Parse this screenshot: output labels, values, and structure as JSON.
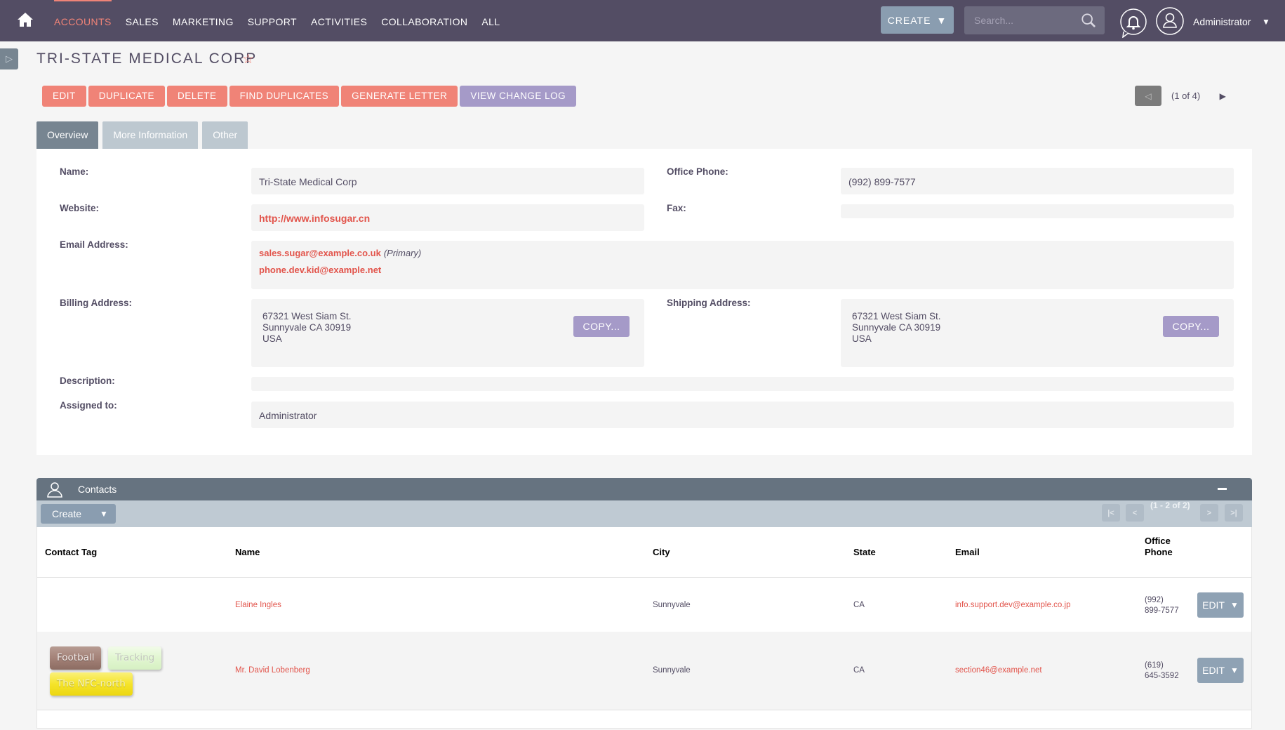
{
  "nav": {
    "items": [
      {
        "label": "ACCOUNTS",
        "active": true
      },
      {
        "label": "SALES",
        "active": false
      },
      {
        "label": "MARKETING",
        "active": false
      },
      {
        "label": "SUPPORT",
        "active": false
      },
      {
        "label": "ACTIVITIES",
        "active": false
      },
      {
        "label": "COLLABORATION",
        "active": false
      },
      {
        "label": "ALL",
        "active": false
      }
    ],
    "create_label": "CREATE",
    "search_placeholder": "Search...",
    "user_name": "Administrator",
    "icons": {
      "home": "home-icon",
      "search": "search-icon",
      "notifications": "bell-icon",
      "user": "user-avatar-icon",
      "caret": "caret-down-icon"
    }
  },
  "colors": {
    "nav_bg": "#534d64",
    "accent": "#f08377",
    "secondary_button": "#a59ac8",
    "link": "#e2544b"
  },
  "record": {
    "title": "TRI-STATE MEDICAL CORP",
    "favorite_icon": "star-outline-icon",
    "actions": [
      "EDIT",
      "DUPLICATE",
      "DELETE",
      "FIND DUPLICATES",
      "GENERATE LETTER",
      "VIEW CHANGE LOG"
    ],
    "pager": {
      "count": "(1 of 4)"
    }
  },
  "tabs": [
    {
      "label": "Overview",
      "active": true
    },
    {
      "label": "More Information",
      "active": false
    },
    {
      "label": "Other",
      "active": false
    }
  ],
  "fields": {
    "name": {
      "label": "Name:",
      "value": "Tri-State Medical Corp"
    },
    "office_phone": {
      "label": "Office Phone:",
      "value": "(992) 899-7577"
    },
    "website": {
      "label": "Website:",
      "value": "http://www.infosugar.cn"
    },
    "fax": {
      "label": "Fax:",
      "value": ""
    },
    "email": {
      "label": "Email Address:",
      "addresses": [
        {
          "value": "sales.sugar@example.co.uk",
          "note": "(Primary)"
        },
        {
          "value": "phone.dev.kid@example.net",
          "note": ""
        }
      ]
    },
    "billing_address": {
      "label": "Billing Address:",
      "line1": "67321 West Siam St.",
      "line2": "Sunnyvale CA  30919",
      "line3": "USA",
      "copy_label": "COPY..."
    },
    "shipping_address": {
      "label": "Shipping Address:",
      "line1": "67321 West Siam St.",
      "line2": "Sunnyvale CA  30919",
      "line3": "USA",
      "copy_label": "COPY..."
    },
    "description": {
      "label": "Description:",
      "value": ""
    },
    "assigned_to": {
      "label": "Assigned to:",
      "value": "Administrator"
    }
  },
  "contacts": {
    "title": "Contacts",
    "create_label": "Create",
    "pagination": {
      "count": "(1 - 2 of 2)",
      "first": "|<",
      "prev": "<",
      "next": ">",
      "last": ">|"
    },
    "columns": [
      "Contact Tag",
      "Name",
      "City",
      "State",
      "Email",
      "Office",
      "Phone"
    ],
    "rows": [
      {
        "tags": [],
        "name": "Elaine Ingles",
        "city": "Sunnyvale",
        "state": "CA",
        "email": "info.support.dev@example.co.jp",
        "phone1": "(992)",
        "phone2": "899-7577",
        "edit_label": "EDIT"
      },
      {
        "tags": [
          "Football",
          "Tracking",
          "The NFC-north"
        ],
        "name": "Mr. David Lobenberg",
        "city": "Sunnyvale",
        "state": "CA",
        "email": "section46@example.net",
        "phone1": "(619)",
        "phone2": "645-3592",
        "edit_label": "EDIT"
      }
    ]
  }
}
